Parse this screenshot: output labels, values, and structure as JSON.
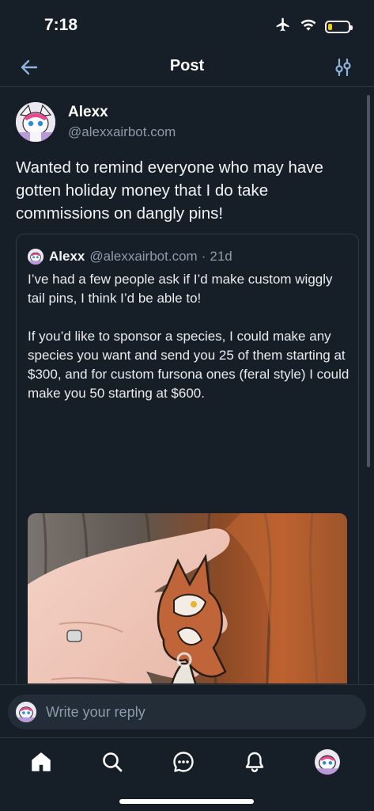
{
  "status_bar": {
    "time": "7:18",
    "icons": [
      "airplane-icon",
      "wifi-icon",
      "battery-icon"
    ],
    "battery_level": 0.2,
    "battery_color": "#ffd60a"
  },
  "header": {
    "title": "Post",
    "left_icon": "arrow-left-icon",
    "right_icon": "filter-sliders-icon"
  },
  "post": {
    "author": {
      "display_name": "Alexx",
      "handle": "@alexxairbot.com"
    },
    "text": "Wanted to remind everyone who may have gotten holiday money that I do take commissions on dangly pins!",
    "quote": {
      "author_name": "Alexx",
      "author_handle": "@alexxairbot.com",
      "separator": "·",
      "age": "21d",
      "paragraphs": [
        "I’ve had a few people ask if I’d make custom wiggly tail pins, I think I’d be able to!",
        "If you’d like to sponsor a species, I could make any species you want and send you 25 of them starting at $300, and for custom fursona ones (feral style) I could make you 50 starting at $600."
      ]
    }
  },
  "reply": {
    "placeholder": "Write your reply"
  },
  "tab_bar": {
    "items": [
      "home-icon",
      "search-icon",
      "chat-icon",
      "bell-icon",
      "profile-avatar"
    ],
    "active": "home-icon"
  },
  "colors": {
    "background": "#161e27",
    "accent": "#208bfe",
    "muted_text": "#8e9ba8",
    "border": "#2b3640"
  }
}
